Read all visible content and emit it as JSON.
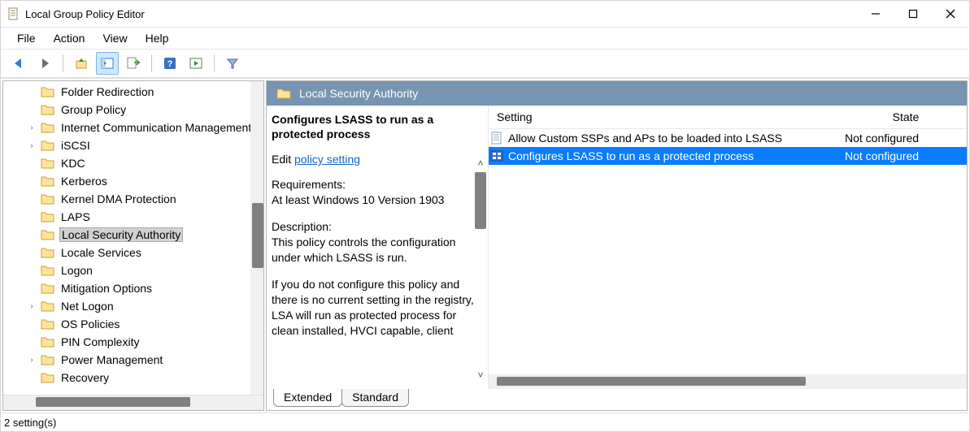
{
  "title_bar": {
    "title": "Local Group Policy Editor"
  },
  "menu": {
    "file": "File",
    "action": "Action",
    "view": "View",
    "help": "Help"
  },
  "tree": {
    "items": [
      {
        "label": "Folder Redirection",
        "expander": ""
      },
      {
        "label": "Group Policy",
        "expander": ""
      },
      {
        "label": "Internet Communication Management",
        "expander": "›"
      },
      {
        "label": "iSCSI",
        "expander": "›"
      },
      {
        "label": "KDC",
        "expander": ""
      },
      {
        "label": "Kerberos",
        "expander": ""
      },
      {
        "label": "Kernel DMA Protection",
        "expander": ""
      },
      {
        "label": "LAPS",
        "expander": ""
      },
      {
        "label": "Local Security Authority",
        "expander": "",
        "selected": true
      },
      {
        "label": "Locale Services",
        "expander": ""
      },
      {
        "label": "Logon",
        "expander": ""
      },
      {
        "label": "Mitigation Options",
        "expander": ""
      },
      {
        "label": "Net Logon",
        "expander": "›"
      },
      {
        "label": "OS Policies",
        "expander": ""
      },
      {
        "label": "PIN Complexity",
        "expander": ""
      },
      {
        "label": "Power Management",
        "expander": "›"
      },
      {
        "label": "Recovery",
        "expander": ""
      }
    ]
  },
  "right": {
    "header": "Local Security Authority",
    "desc_title": "Configures LSASS to run as a protected process",
    "edit_prefix": "Edit ",
    "edit_link": "policy setting",
    "req_label": "Requirements:",
    "req_value": "At least Windows 10 Version 1903",
    "desc_label": "Description:",
    "desc_p1": "This policy controls the configuration under which LSASS is run.",
    "desc_p2": "If you do not configure this policy and there is no current setting in the registry, LSA will run as protected process for clean installed, HVCI capable, client",
    "columns": {
      "setting": "Setting",
      "state": "State"
    },
    "rows": [
      {
        "name": "Allow Custom SSPs and APs to be loaded into LSASS",
        "state": "Not configured",
        "icon": "policy"
      },
      {
        "name": "Configures LSASS to run as a protected process",
        "state": "Not configured",
        "icon": "policy-sel",
        "selected": true
      }
    ],
    "tabs": {
      "extended": "Extended",
      "standard": "Standard"
    }
  },
  "status": {
    "text": "2 setting(s)"
  }
}
